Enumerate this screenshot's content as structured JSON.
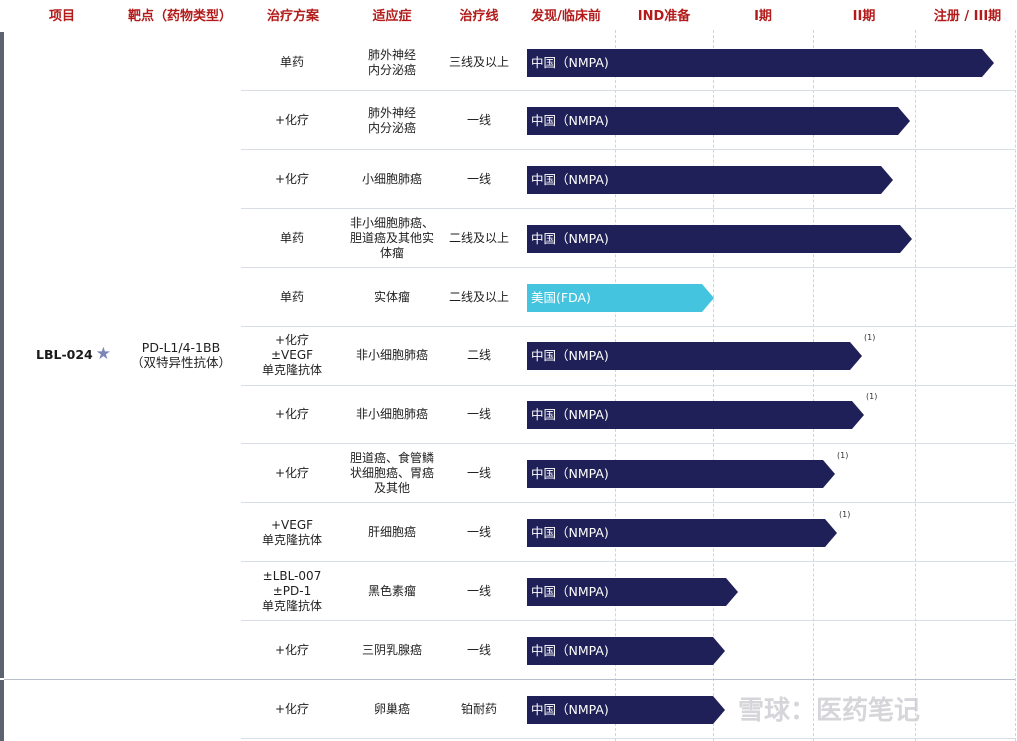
{
  "header": [
    "项目",
    "靶点（药物类型）",
    "治疗方案",
    "适应症",
    "治疗线",
    "发现/临床前",
    "IND准备",
    "I期",
    "II期",
    "注册 / III期"
  ],
  "project": {
    "name": "LBL-024",
    "star": "★",
    "target": "PD-L1/4-1BB\n（双特异性抗体）"
  },
  "rows": [
    {
      "regimen": "单药",
      "indication": "肺外神经\n内分泌癌",
      "line": "三线及以上",
      "region": "中国（NMPA)",
      "color": "#1f2057",
      "progress": "注册/III期",
      "note": ""
    },
    {
      "regimen": "+化疗",
      "indication": "肺外神经\n内分泌癌",
      "line": "一线",
      "region": "中国（NMPA)",
      "color": "#1f2057",
      "progress": "II期（后段）",
      "note": ""
    },
    {
      "regimen": "+化疗",
      "indication": "小细胞肺癌",
      "line": "一线",
      "region": "中国（NMPA)",
      "color": "#1f2057",
      "progress": "II期",
      "note": ""
    },
    {
      "regimen": "单药",
      "indication": "非小细胞肺癌、\n胆道癌及其他实\n体瘤",
      "line": "二线及以上",
      "region": "中国（NMPA)",
      "color": "#1f2057",
      "progress": "II期（后段）",
      "note": ""
    },
    {
      "regimen": "单药",
      "indication": "实体瘤",
      "line": "二线及以上",
      "region": "美国(FDA)",
      "color": "#45c4e0",
      "progress": "IND准备",
      "note": ""
    },
    {
      "regimen": "+化疗\n±VEGF\n单克隆抗体",
      "indication": "非小细胞肺癌",
      "line": "二线",
      "region": "中国（NMPA)",
      "color": "#1f2057",
      "progress": "II期",
      "note": "(1)"
    },
    {
      "regimen": "+化疗",
      "indication": "非小细胞肺癌",
      "line": "一线",
      "region": "中国（NMPA)",
      "color": "#1f2057",
      "progress": "II期",
      "note": "(1)"
    },
    {
      "regimen": "+化疗",
      "indication": "胆道癌、食管鳞\n状细胞癌、胃癌\n及其他",
      "line": "一线",
      "region": "中国（NMPA)",
      "color": "#1f2057",
      "progress": "II期",
      "note": "(1)"
    },
    {
      "regimen": "+VEGF\n单克隆抗体",
      "indication": "肝细胞癌",
      "line": "一线",
      "region": "中国（NMPA)",
      "color": "#1f2057",
      "progress": "II期",
      "note": "(1)"
    },
    {
      "regimen": "±LBL-007\n±PD-1\n单克隆抗体",
      "indication": "黑色素瘤",
      "line": "一线",
      "region": "中国（NMPA)",
      "color": "#1f2057",
      "progress": "I期",
      "note": ""
    },
    {
      "regimen": "+化疗",
      "indication": "三阴乳腺癌",
      "line": "一线",
      "region": "中国（NMPA)",
      "color": "#1f2057",
      "progress": "I期",
      "note": ""
    },
    {
      "regimen": "+化疗",
      "indication": "卵巢癌",
      "line": "铂耐药",
      "region": "中国（NMPA)",
      "color": "#1f2057",
      "progress": "I期",
      "note": ""
    }
  ],
  "watermark": "雪球：医药笔记"
}
